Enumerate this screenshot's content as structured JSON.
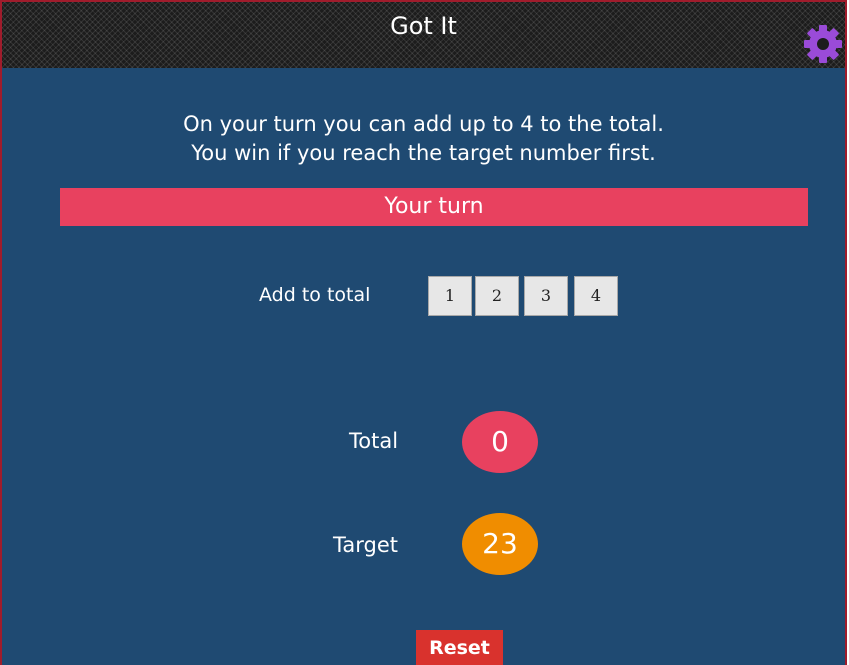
{
  "header": {
    "title": "Got It",
    "settings_icon": "gear-icon",
    "settings_color": "#9a4bd8"
  },
  "instructions": {
    "line1": "On your turn you can add up to 4 to the total.",
    "line2": "You win if you reach the target number first."
  },
  "status": {
    "text": "Your turn",
    "color": "#e8415f"
  },
  "controls": {
    "add_label": "Add to total",
    "buttons": [
      "1",
      "2",
      "3",
      "4"
    ]
  },
  "scores": {
    "total_label": "Total",
    "total_value": "0",
    "total_color": "#e8415f",
    "target_label": "Target",
    "target_value": "23",
    "target_color": "#f08d00"
  },
  "reset": {
    "label": "Reset",
    "color": "#d9322d"
  },
  "theme": {
    "background": "#1f4a72"
  }
}
